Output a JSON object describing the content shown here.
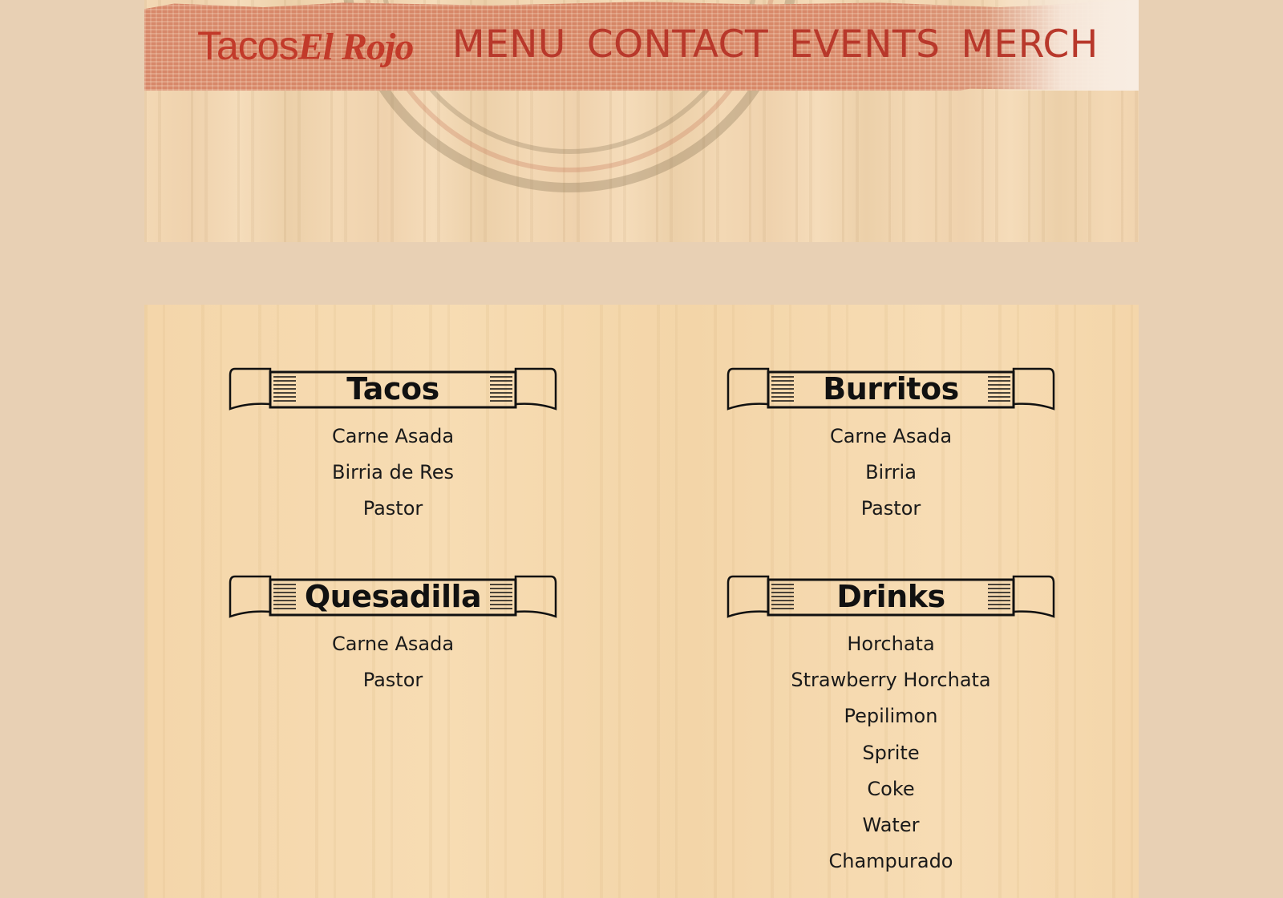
{
  "header": {
    "brand": {
      "tacos": "Tacos",
      "elrojo": "El Rojo"
    },
    "nav": [
      {
        "label": "MENU"
      },
      {
        "label": "CONTACT"
      },
      {
        "label": "EVENTS"
      },
      {
        "label": "MERCH"
      }
    ]
  },
  "menu": {
    "sections": [
      {
        "title": "Tacos",
        "items": [
          "Carne Asada",
          "Birria de Res",
          "Pastor"
        ]
      },
      {
        "title": "Burritos",
        "items": [
          "Carne Asada",
          "Birria",
          "Pastor"
        ]
      },
      {
        "title": "Quesadilla",
        "items": [
          "Carne Asada",
          "Pastor"
        ]
      },
      {
        "title": "Drinks",
        "items": [
          "Horchata",
          "Strawberry Horchata",
          "Pepilimon",
          "Sprite",
          "Coke",
          "Water",
          "Champurado"
        ]
      }
    ]
  },
  "colors": {
    "page_background": "#e8d0b4",
    "brand_red": "#c23a2a",
    "nav_band": "#d7886a",
    "menu_wood": "#f4d6aa"
  }
}
